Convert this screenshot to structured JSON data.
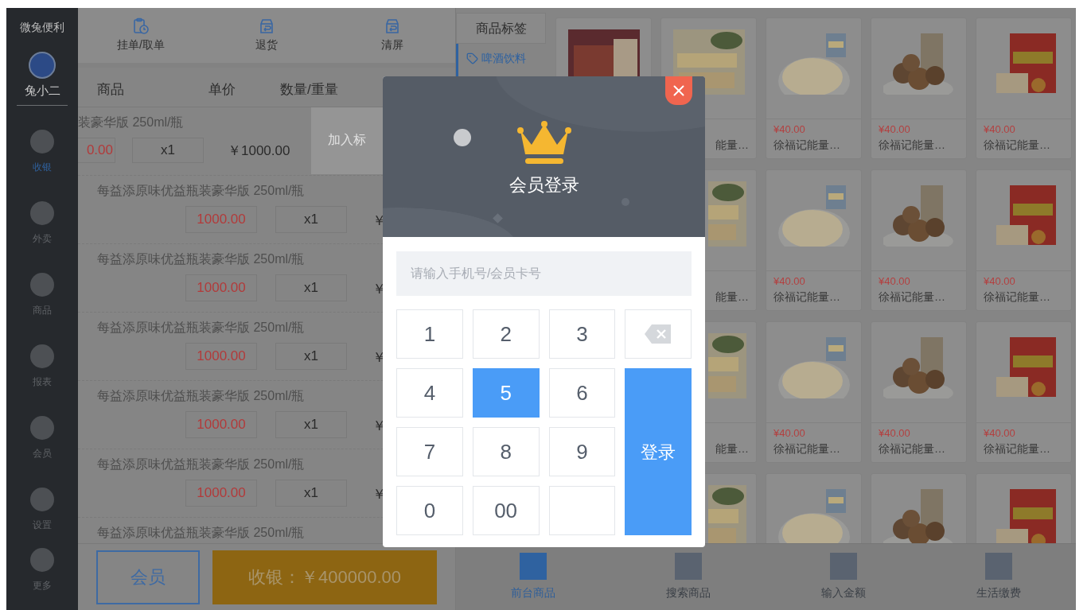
{
  "sidebar": {
    "brand": "微兔便利",
    "user": "兔小二",
    "items": [
      {
        "label": "收银",
        "selected": true,
        "kind": "main"
      },
      {
        "label": "外卖",
        "selected": false,
        "kind": "main"
      },
      {
        "label": "商品",
        "selected": false,
        "kind": "main"
      },
      {
        "label": "报表",
        "selected": false,
        "kind": "main"
      },
      {
        "label": "会员",
        "selected": false,
        "kind": "main"
      },
      {
        "label": "设置",
        "selected": false,
        "kind": "main"
      },
      {
        "label": "更多",
        "selected": false,
        "kind": "bottom"
      }
    ]
  },
  "toolbar": [
    {
      "label": "挂单/取单",
      "kind": "hold"
    },
    {
      "label": "退货",
      "kind": "return"
    },
    {
      "label": "清屏",
      "kind": "clear"
    }
  ],
  "order_table": {
    "columns": [
      "商品",
      "单价",
      "数量/重量"
    ],
    "swiped_row": {
      "name_tail": "装豪华版 250ml/瓶",
      "price_tail": "0.00",
      "shifted_quantity": "x1",
      "shifted_total": "￥1000.00",
      "action": "加入标"
    },
    "rows": [
      {
        "kind": "normal",
        "name": "每益添原味优益瓶装豪华版 250ml/瓶",
        "price": "1000.00",
        "quantity": "x1",
        "total": "￥"
      },
      {
        "kind": "normal",
        "name": "每益添原味优益瓶装豪华版 250ml/瓶",
        "price": "1000.00",
        "quantity": "x1",
        "total": "￥"
      },
      {
        "kind": "normal",
        "name": "每益添原味优益瓶装豪华版 250ml/瓶",
        "price": "1000.00",
        "quantity": "x1",
        "total": "￥"
      },
      {
        "kind": "normal",
        "name": "每益添原味优益瓶装豪华版 250ml/瓶",
        "price": "1000.00",
        "quantity": "x1",
        "total": "￥"
      },
      {
        "kind": "normal",
        "name": "每益添原味优益瓶装豪华版 250ml/瓶",
        "price": "1000.00",
        "quantity": "x1",
        "total": "￥"
      },
      {
        "kind": "name_only",
        "name": "每益添原味优益瓶装豪华版 250ml/瓶"
      }
    ]
  },
  "footer": {
    "member_button": "会员",
    "checkout_button": "收银：￥400000.00"
  },
  "tags": {
    "title": "商品标签",
    "items": [
      {
        "label": "啤酒饮料",
        "selected": true
      }
    ]
  },
  "product_rows": [
    [
      {
        "kind": "image_only"
      },
      {
        "kind": "partial",
        "name": "能量…"
      },
      {
        "kind": "full",
        "price": "¥40.00",
        "name": "徐福记能量…"
      },
      {
        "kind": "full",
        "price": "¥40.00",
        "name": "徐福记能量…"
      },
      {
        "kind": "full",
        "price": "¥40.00",
        "name": "徐福记能量…"
      }
    ],
    [
      {
        "kind": "partial",
        "name": "能量…"
      },
      {
        "kind": "full",
        "price": "¥40.00",
        "name": "徐福记能量…"
      },
      {
        "kind": "full",
        "price": "¥40.00",
        "name": "徐福记能量…"
      },
      {
        "kind": "full",
        "price": "¥40.00",
        "name": "徐福记能量…"
      }
    ],
    [
      {
        "kind": "partial",
        "name": "能量…"
      },
      {
        "kind": "full",
        "price": "¥40.00",
        "name": "徐福记能量…"
      },
      {
        "kind": "full",
        "price": "¥40.00",
        "name": "徐福记能量…"
      },
      {
        "kind": "full",
        "price": "¥40.00",
        "name": "徐福记能量…"
      }
    ],
    [
      {
        "kind": "image_only"
      },
      {
        "kind": "image_only"
      },
      {
        "kind": "image_only"
      },
      {
        "kind": "image_only"
      }
    ]
  ],
  "bottom_nav": [
    {
      "label": "前台商品",
      "selected": true
    },
    {
      "label": "搜索商品",
      "selected": false
    },
    {
      "label": "输入金额",
      "selected": false
    },
    {
      "label": "生活缴费",
      "selected": false
    }
  ],
  "modal": {
    "title": "会员登录",
    "placeholder": "请输入手机号/会员卡号",
    "keys": [
      {
        "kind": "digit",
        "label": "1",
        "selected": false
      },
      {
        "kind": "digit",
        "label": "2",
        "selected": false
      },
      {
        "kind": "digit",
        "label": "3",
        "selected": false
      },
      {
        "kind": "backspace"
      },
      {
        "kind": "digit",
        "label": "4",
        "selected": false
      },
      {
        "kind": "digit",
        "label": "5",
        "selected": true
      },
      {
        "kind": "digit",
        "label": "6",
        "selected": false
      },
      {
        "kind": "digit",
        "label": "7",
        "selected": false
      },
      {
        "kind": "digit",
        "label": "8",
        "selected": false
      },
      {
        "kind": "digit",
        "label": "9",
        "selected": false
      },
      {
        "kind": "digit",
        "label": "0",
        "selected": false
      },
      {
        "kind": "digit",
        "label": "00",
        "selected": false
      },
      {
        "kind": "blank"
      },
      {
        "kind": "submit",
        "label": "登录"
      }
    ]
  }
}
